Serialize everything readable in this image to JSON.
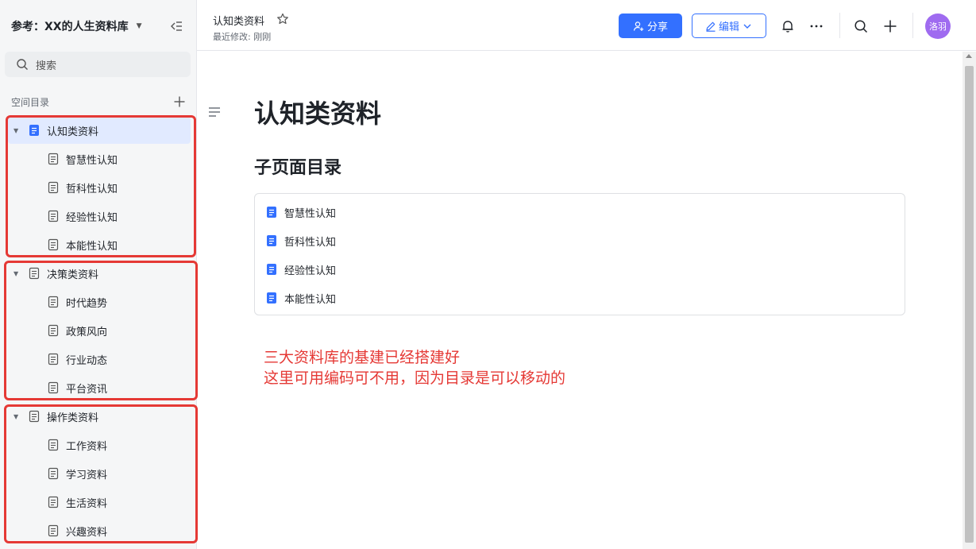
{
  "sidebar": {
    "space_title": "参考：XX的人生资料库",
    "search_placeholder": "搜索",
    "directory_label": "空间目录",
    "groups": [
      {
        "label": "认知类资料",
        "active": true,
        "children": [
          "智慧性认知",
          "哲科性认知",
          "经验性认知",
          "本能性认知"
        ]
      },
      {
        "label": "决策类资料",
        "active": false,
        "children": [
          "时代趋势",
          "政策风向",
          "行业动态",
          "平台资讯"
        ]
      },
      {
        "label": "操作类资料",
        "active": false,
        "children": [
          "工作资料",
          "学习资料",
          "生活资料",
          "兴趣资料"
        ]
      }
    ]
  },
  "topbar": {
    "doc_title": "认知类资料",
    "modified": "最近修改: 刚刚",
    "share_label": "分享",
    "edit_label": "编辑",
    "avatar_text": "洛羽"
  },
  "main": {
    "title": "认知类资料",
    "subpages_heading": "子页面目录",
    "subpages": [
      "智慧性认知",
      "哲科性认知",
      "经验性认知",
      "本能性认知"
    ],
    "note_lines": [
      "三大资料库的基建已经搭建好",
      "这里可用编码可不用，因为目录是可以移动的"
    ]
  },
  "colors": {
    "accent": "#3370ff",
    "annotation_red": "#e53935",
    "avatar": "#9f6bf0"
  }
}
